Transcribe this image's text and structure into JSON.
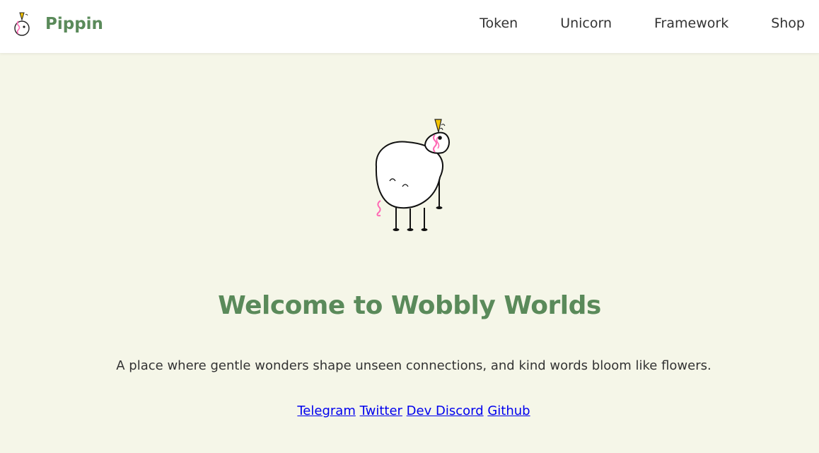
{
  "navbar": {
    "brand_name": "Pippin",
    "brand_logo_icon": "unicorn-logo-icon",
    "links": [
      {
        "label": "Token"
      },
      {
        "label": "Unicorn"
      },
      {
        "label": "Framework"
      },
      {
        "label": "Shop"
      }
    ]
  },
  "hero": {
    "image_icon": "pippin-unicorn-illustration",
    "title": "Welcome to Wobbly Worlds",
    "subtitle": "A place where gentle wonders shape unseen connections, and kind words bloom like flowers.",
    "links": [
      {
        "label": "Telegram"
      },
      {
        "label": "Twitter"
      },
      {
        "label": "Dev Discord"
      },
      {
        "label": "Github"
      }
    ]
  },
  "colors": {
    "background": "#f5f6e8",
    "navbar_background": "#ffffff",
    "brand_green": "#5a8a5a",
    "text": "#333333",
    "link_blue": "#0000ee",
    "horn_yellow": "#f5c400",
    "mane_pink": "#ff69b4"
  }
}
